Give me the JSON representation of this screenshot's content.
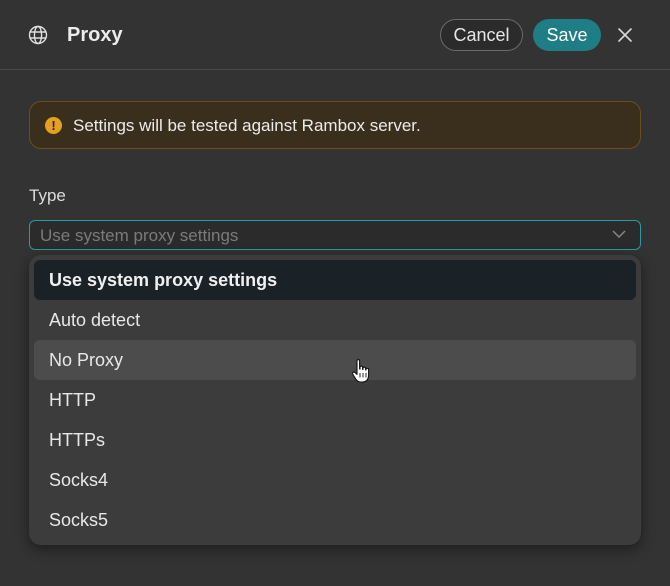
{
  "header": {
    "icon": "globe-icon",
    "title": "Proxy",
    "cancel_label": "Cancel",
    "save_label": "Save",
    "close_icon": "close-icon"
  },
  "alert": {
    "icon": "warning-icon",
    "icon_glyph": "!",
    "text": "Settings will be tested against Rambox server."
  },
  "type_field": {
    "label": "Type",
    "selected_value": "Use system proxy settings",
    "dropdown_open": true,
    "options": [
      {
        "label": "Use system proxy settings",
        "selected": true
      },
      {
        "label": "Auto detect"
      },
      {
        "label": "No Proxy",
        "hovered": true
      },
      {
        "label": "HTTP"
      },
      {
        "label": "HTTPs"
      },
      {
        "label": "Socks4"
      },
      {
        "label": "Socks5"
      }
    ]
  },
  "colors": {
    "background": "#333333",
    "accent": "#1f7d86",
    "focus_border": "#2a9aa3",
    "warning": "#e4a020"
  }
}
